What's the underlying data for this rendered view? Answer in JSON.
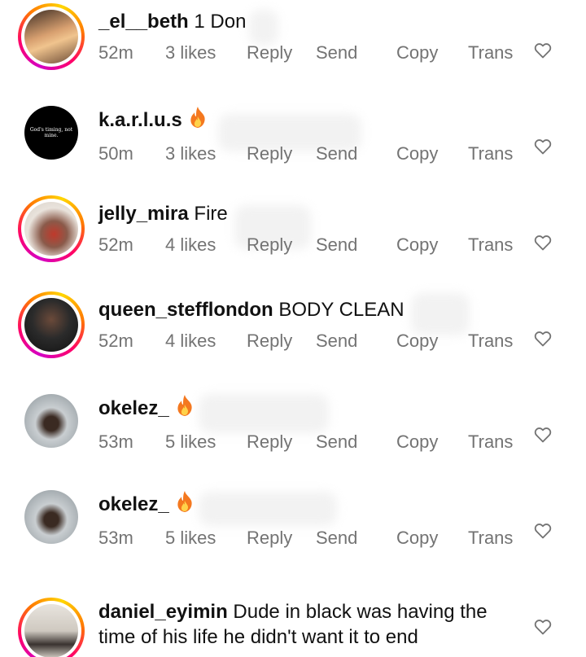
{
  "comments": [
    {
      "username": "_el__beth",
      "text": "1 Don",
      "time": "52m",
      "likes": "3 likes",
      "avatar_style": "ring",
      "avatar_color": "#c79a6b",
      "avatar_text": ""
    },
    {
      "username": "k.a.r.l.u.s",
      "text": "🔥",
      "time": "50m",
      "likes": "3 likes",
      "avatar_style": "plain",
      "avatar_color": "#000000",
      "avatar_text": "God's timing, not mine."
    },
    {
      "username": "jelly_mira",
      "text": "Fire",
      "time": "52m",
      "likes": "4 likes",
      "avatar_style": "ring",
      "avatar_color": "#8a6a5a",
      "avatar_text": ""
    },
    {
      "username": "queen_stefflondon",
      "text": "BODY CLEAN",
      "time": "52m",
      "likes": "4 likes",
      "avatar_style": "ring",
      "avatar_color": "#2b2b2b",
      "avatar_text": ""
    },
    {
      "username": "okelez_",
      "text": "🔥",
      "time": "53m",
      "likes": "5 likes",
      "avatar_style": "plain",
      "avatar_color": "#9aa3a8",
      "avatar_text": ""
    },
    {
      "username": "okelez_",
      "text": "🔥",
      "time": "53m",
      "likes": "5 likes",
      "avatar_style": "plain",
      "avatar_color": "#9aa3a8",
      "avatar_text": ""
    },
    {
      "username": "daniel_eyimin",
      "text": "Dude in black was having the time of his life he didn't want it to end",
      "time": "",
      "likes": "",
      "avatar_style": "ring",
      "avatar_color": "#cfc9c0",
      "avatar_text": ""
    }
  ],
  "actions": {
    "reply": "Reply",
    "send": "Send",
    "copy": "Copy",
    "translate": "Trans"
  },
  "icons": {
    "like": "heart-outline-icon",
    "fire": "fire-emoji-icon"
  },
  "colors": {
    "text": "#111111",
    "meta": "#737373",
    "ring_start": "#d300c5",
    "ring_mid": "#ff0069",
    "ring_end": "#ffd600"
  }
}
